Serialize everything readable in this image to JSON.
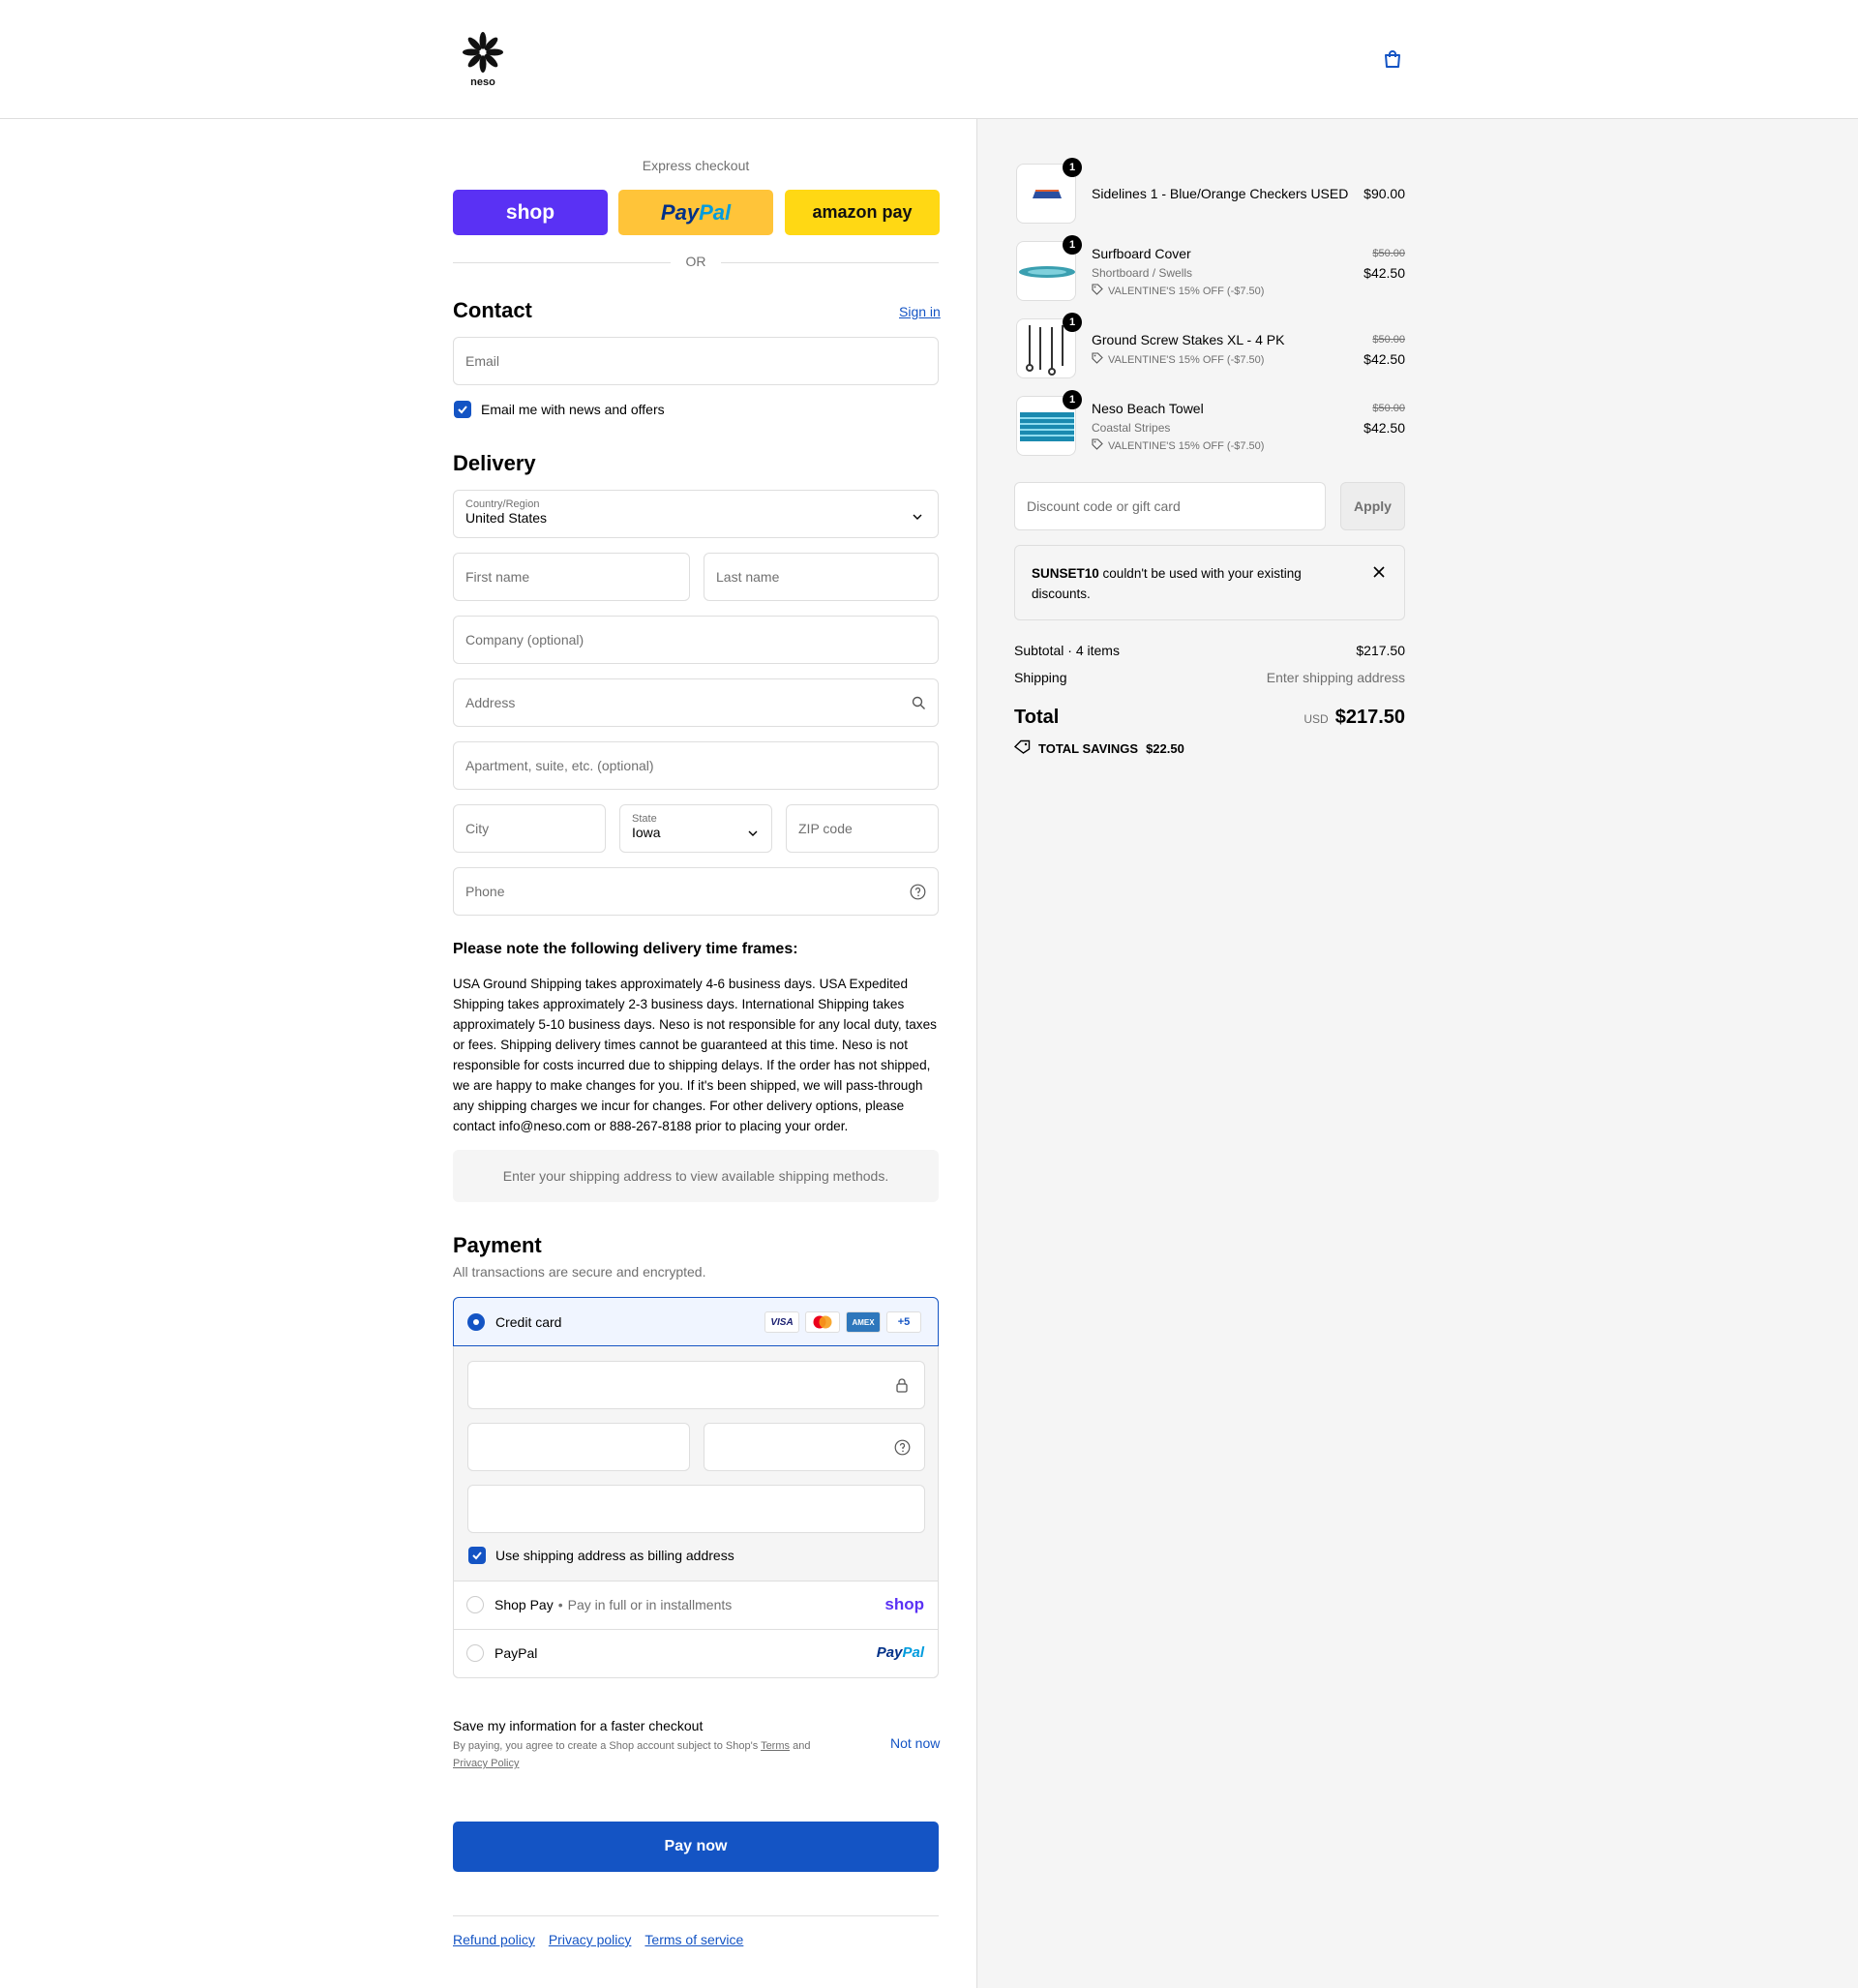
{
  "brand": {
    "logo_text": "neso"
  },
  "express": {
    "heading": "Express checkout",
    "shop": "shop",
    "paypal_a": "Pay",
    "paypal_b": "Pal",
    "amazon": "amazon pay",
    "or": "OR"
  },
  "contact": {
    "heading": "Contact",
    "sign_in": "Sign in",
    "email_placeholder": "Email",
    "news_label": "Email me with news and offers"
  },
  "delivery": {
    "heading": "Delivery",
    "country_label": "Country/Region",
    "country_value": "United States",
    "first_name": "First name",
    "last_name": "Last name",
    "company": "Company (optional)",
    "address": "Address",
    "apartment": "Apartment, suite, etc. (optional)",
    "city": "City",
    "state_label": "State",
    "state_value": "Iowa",
    "zip": "ZIP code",
    "phone": "Phone"
  },
  "notice": {
    "heading": "Please note the following delivery time frames:",
    "body": "USA Ground Shipping takes approximately 4-6 business days. USA Expedited Shipping takes approximately 2-3 business days. International Shipping takes approximately 5-10 business days. Neso is not responsible for any local duty, taxes or fees. Shipping delivery times cannot be guaranteed at this time. Neso is not responsible for costs incurred due to shipping delays. If the order has not shipped, we are happy to make changes for you. If it's been shipped, we will pass-through any shipping charges we incur for changes. For other delivery options, please contact info@neso.com or 888-267-8188 prior to placing your order.",
    "shipping_methods": "Enter your shipping address to view available shipping methods."
  },
  "payment": {
    "heading": "Payment",
    "subheading": "All transactions are secure and encrypted.",
    "credit_card": "Credit card",
    "visa": "VISA",
    "amex": "AMEX",
    "more_cards": "+5",
    "billing_label": "Use shipping address as billing address",
    "shop_pay": "Shop Pay",
    "shop_pay_sep": "•",
    "shop_pay_note": "Pay in full or in installments",
    "shop_logo": "shop",
    "paypal": "PayPal",
    "paypal_logo_a": "Pay",
    "paypal_logo_b": "Pal"
  },
  "save_info": {
    "title": "Save my information for a faster checkout",
    "terms_pre": "By paying, you agree to create a Shop account subject to Shop's",
    "terms": "Terms",
    "and": "and",
    "privacy": "Privacy Policy",
    "not_now": "Not now"
  },
  "pay_now": "Pay now",
  "footer_links": [
    "Refund policy",
    "Privacy policy",
    "Terms of service"
  ],
  "cart": {
    "items": [
      {
        "qty": "1",
        "name": "Sidelines 1 - Blue/Orange Checkers USED",
        "variant": "",
        "discount": "",
        "original": "",
        "price": "$90.00"
      },
      {
        "qty": "1",
        "name": "Surfboard Cover",
        "variant": "Shortboard / Swells",
        "discount": "VALENTINE'S 15% OFF (-$7.50)",
        "original": "$50.00",
        "price": "$42.50"
      },
      {
        "qty": "1",
        "name": "Ground Screw Stakes XL - 4 PK",
        "variant": "",
        "discount": "VALENTINE'S 15% OFF (-$7.50)",
        "original": "$50.00",
        "price": "$42.50"
      },
      {
        "qty": "1",
        "name": "Neso Beach Towel",
        "variant": "Coastal Stripes",
        "discount": "VALENTINE'S 15% OFF (-$7.50)",
        "original": "$50.00",
        "price": "$42.50"
      }
    ],
    "discount_placeholder": "Discount code or gift card",
    "apply": "Apply",
    "error_code": "SUNSET10",
    "error_text": "couldn't be used with your existing discounts.",
    "subtotal_label": "Subtotal · 4 items",
    "subtotal_value": "$217.50",
    "shipping_label": "Shipping",
    "shipping_value": "Enter shipping address",
    "total_label": "Total",
    "currency": "USD",
    "total_value": "$217.50",
    "savings_label": "TOTAL SAVINGS",
    "savings_value": "$22.50"
  },
  "colors": {
    "accent": "#1454c4",
    "shop": "#5a31f4",
    "paypal_btn": "#ffc439",
    "amazon_btn": "#ffd814",
    "sidebar_bg": "#f5f5f5"
  }
}
